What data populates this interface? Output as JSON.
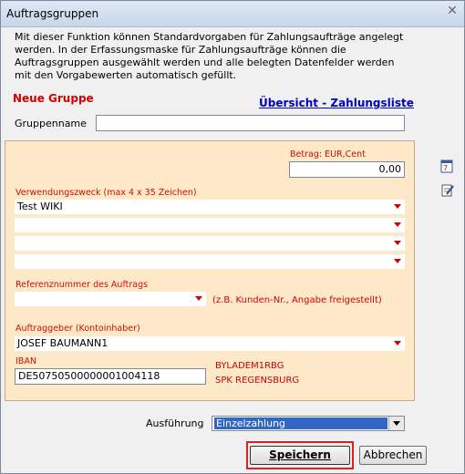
{
  "window": {
    "title": "Auftragsgruppen"
  },
  "intro": {
    "line1": "Mit dieser Funktion können Standardvorgaben für Zahlungsaufträge angelegt",
    "line2": "werden. In der Erfassungsmaske für Zahlungsaufträge können die",
    "line3": "Auftragsgruppen ausgewählt werden und alle belegten Datenfelder werden",
    "line4": "mit den Vorgabewerten automatisch gefüllt."
  },
  "heading": "Neue Gruppe",
  "overview_link": "Übersicht - Zahlungsliste",
  "group_name": {
    "label": "Gruppenname",
    "value": ""
  },
  "amount": {
    "label": "Betrag: EUR,Cent",
    "value": "0,00"
  },
  "purpose": {
    "label": "Verwendungszweck (max 4 x 35 Zeichen)",
    "lines": [
      "Test WIKI",
      "",
      "",
      ""
    ]
  },
  "reference": {
    "label": "Referenznummer des Auftrags",
    "value": "",
    "hint": "(z.B. Kunden-Nr., Angabe freigestellt)"
  },
  "payer": {
    "label": "Auftraggeber (Kontoinhaber)",
    "value": "JOSEF BAUMANN1"
  },
  "iban": {
    "label": "IBAN",
    "value": "DE50750500000001004118",
    "bic": "BYLADEM1RBG",
    "bank": "SPK REGENSBURG"
  },
  "execution": {
    "label": "Ausführung",
    "selected": "Einzelzahlung"
  },
  "buttons": {
    "save": "Speichern",
    "cancel": "Abbrechen"
  },
  "icons": [
    "calendar-icon",
    "edit-note-icon"
  ],
  "colors": {
    "accent_red": "#d40000",
    "panel_bg": "#fde8c8",
    "link": "#0000cc",
    "selection": "#3168c6"
  }
}
